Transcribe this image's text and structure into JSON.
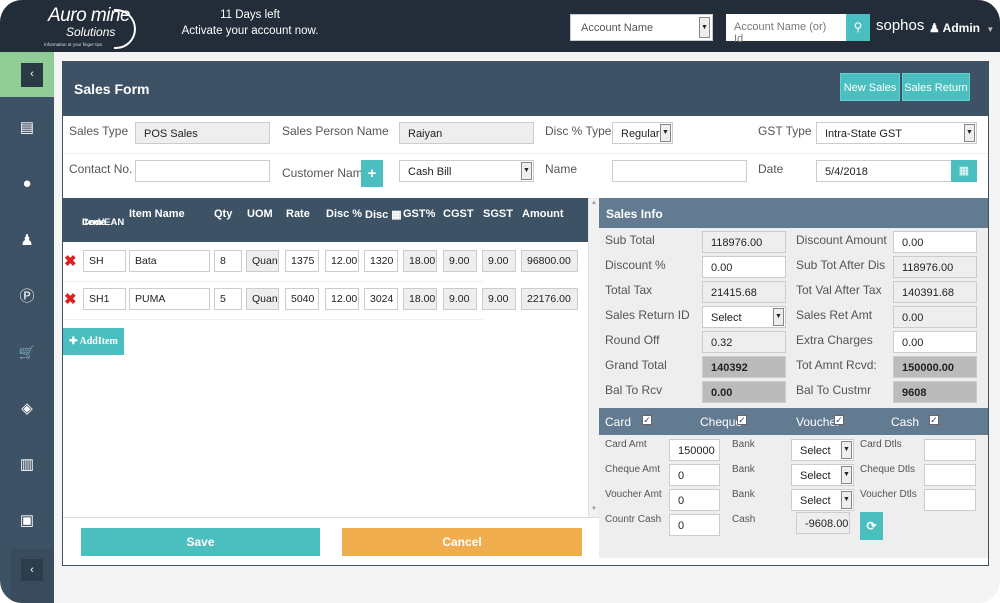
{
  "topbar": {
    "logo_line1": "Auro mine",
    "logo_line2": "Solutions",
    "logo_tagline": "Information at your finger tips",
    "trial_days": "11 Days left",
    "trial_message": "Activate your account now.",
    "account_select_value": "Account Name",
    "account_search_placeholder": "Account Name (or) Id",
    "brand": "sophos",
    "user": "Admin",
    "icons": {
      "search": "search-icon",
      "user": "user-icon",
      "caret": "caret-down-icon"
    }
  },
  "sidebar": {
    "items": [
      {
        "icon": "book-icon",
        "glyph": "▤"
      },
      {
        "icon": "user-icon",
        "glyph": "●"
      },
      {
        "icon": "person-icon",
        "glyph": "♟"
      },
      {
        "icon": "parking-icon",
        "glyph": "Ⓟ"
      },
      {
        "icon": "cart-icon",
        "glyph": "🛒"
      },
      {
        "icon": "tag-icon",
        "glyph": "◈"
      },
      {
        "icon": "bar-chart-icon",
        "glyph": "▥"
      },
      {
        "icon": "newspaper-icon",
        "glyph": "▣"
      }
    ],
    "collapse_glyph": "‹"
  },
  "form": {
    "title": "Sales Form",
    "new_sales_label": "New Sales",
    "sales_return_label": "Sales Return",
    "sales_type_label": "Sales Type",
    "sales_type_value": "POS Sales",
    "sales_person_label": "Sales Person Name",
    "sales_person_value": "Raiyan",
    "disc_type_label": "Disc % Type",
    "disc_type_value": "Regular",
    "gst_type_label": "GST Type",
    "gst_type_value": "Intra-State GST",
    "contact_label": "Contact No.",
    "contact_value": "",
    "customer_label": "Customer Name",
    "customer_value": "Cash Bill",
    "name_label": "Name",
    "name_value": "",
    "date_label": "Date",
    "date_value": "5/4/2018"
  },
  "items": {
    "headers": {
      "code_line1": "Item/EAN",
      "code_line2": "Code",
      "name": "Item Name",
      "qty": "Qty",
      "uom": "UOM",
      "rate": "Rate",
      "disc_pct": "Disc %",
      "disc_amt": "Disc ▦",
      "gst": "GST%",
      "cgst": "CGST",
      "sgst": "SGST",
      "amount": "Amount"
    },
    "rows": [
      {
        "code": "SH",
        "name": "Bata",
        "qty": "8",
        "uom": "Quan",
        "rate": "1375",
        "disc_pct": "12.00",
        "disc_amt": "1320",
        "gst": "18.00",
        "cgst": "9.00",
        "sgst": "9.00",
        "amount": "96800.00"
      },
      {
        "code": "SH1",
        "name": "PUMA",
        "qty": "5",
        "uom": "Quan",
        "rate": "5040",
        "disc_pct": "12.00",
        "disc_amt": "3024",
        "gst": "18.00",
        "cgst": "9.00",
        "sgst": "9.00",
        "amount": "22176.00"
      }
    ],
    "add_item_label": "✚ AddItem",
    "save_label": "Save",
    "cancel_label": "Cancel"
  },
  "sales_info": {
    "title": "Sales Info",
    "sub_total_label": "Sub Total",
    "sub_total": "118976.00",
    "discount_pct_label": "Discount %",
    "discount_pct": "0.00",
    "total_tax_label": "Total Tax",
    "total_tax": "21415.68",
    "sales_return_id_label": "Sales Return ID",
    "sales_return_id": "Select",
    "round_off_label": "Round Off",
    "round_off": "0.32",
    "grand_total_label": "Grand Total",
    "grand_total": "140392",
    "bal_to_rcv_label": "Bal To Rcv",
    "bal_to_rcv": "0.00",
    "discount_amount_label": "Discount Amount",
    "discount_amount": "0.00",
    "sub_tot_after_dis_label": "Sub Tot After Dis",
    "sub_tot_after_dis": "118976.00",
    "tot_val_after_tax_label": "Tot Val After Tax",
    "tot_val_after_tax": "140391.68",
    "sales_ret_amt_label": "Sales Ret Amt",
    "sales_ret_amt": "0.00",
    "extra_charges_label": "Extra Charges",
    "extra_charges": "0.00",
    "tot_amnt_rcvd_label": "Tot Amnt Rcvd:",
    "tot_amnt_rcvd": "150000.00",
    "bal_to_custmr_label": "Bal To Custmr",
    "bal_to_custmr": "9608"
  },
  "payment": {
    "card_label": "Card",
    "card_checked": true,
    "cheque_label": "Cheque",
    "cheque_checked": true,
    "voucher_label": "Voucher",
    "voucher_checked": true,
    "cash_label": "Cash",
    "cash_checked": true,
    "check_glyph": "✓",
    "card_amt_label": "Card Amt",
    "card_amt": "150000",
    "cheque_amt_label": "Cheque Amt",
    "cheque_amt": "0",
    "voucher_amt_label": "Voucher Amt",
    "voucher_amt": "0",
    "countr_cash_label": "Countr Cash",
    "countr_cash": "0",
    "bank_label": "Bank",
    "cash_label2": "Cash",
    "bank_select": "Select",
    "cash_value": "-9608.00",
    "card_dtls_label": "Card Dtls",
    "cheque_dtls_label": "Cheque Dtls",
    "voucher_dtls_label": "Voucher Dtls",
    "card_dtls": "",
    "cheque_dtls": "",
    "voucher_dtls": ""
  }
}
